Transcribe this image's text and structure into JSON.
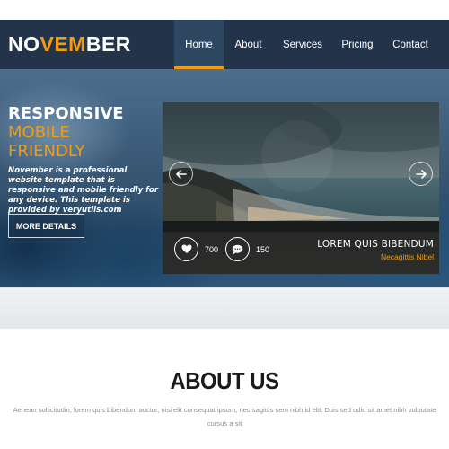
{
  "brand": {
    "logo_part1": "NO",
    "logo_part2": "VEM",
    "logo_part3": "BER",
    "accent_color": "#f39c12",
    "nav_color": "#23344a"
  },
  "nav": {
    "items": [
      {
        "label": "Home",
        "active": true
      },
      {
        "label": "About"
      },
      {
        "label": "Services"
      },
      {
        "label": "Pricing"
      },
      {
        "label": "Contact"
      }
    ]
  },
  "hero": {
    "title_line1": "RESPONSIVE",
    "title_line2": "MOBILE",
    "title_line3": "FRIENDLY",
    "description": "November is a professional website template that is responsive and mobile friendly for any device. This template is provided by veryutils.com",
    "button_label": "MORE DETAILS"
  },
  "slider": {
    "likes": "700",
    "comments": "150",
    "caption_title": "LOREM QUIS BIBENDUM",
    "caption_subtitle": "Necagittis Nibel",
    "prev_icon": "arrow-left-icon",
    "next_icon": "arrow-right-icon",
    "like_icon": "heart-icon",
    "comment_icon": "comment-icon"
  },
  "about": {
    "title": "ABOUT US",
    "text": "Aenean sollicitudin, lorem quis bibendum auctor, nisi elit consequat ipsum, nec sagittis sem nibh id elit. Duis sed odio sit amet nibh vulputate cursus a sit"
  }
}
